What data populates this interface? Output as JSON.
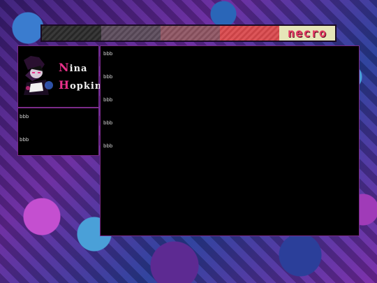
{
  "header": {
    "logo_text": "necro"
  },
  "profile": {
    "first_cap": "N",
    "first_rest": "ina",
    "last_cap": "H",
    "last_rest": "opkins"
  },
  "sidebar": {
    "items": [
      "bbb",
      "bbb"
    ]
  },
  "main": {
    "items": [
      "bbb",
      "bbb",
      "bbb",
      "bbb",
      "bbb"
    ]
  },
  "colors": {
    "name_accent": "#e8318a",
    "logo_color": "#e43d66",
    "panel_border": "#7a2a88"
  }
}
